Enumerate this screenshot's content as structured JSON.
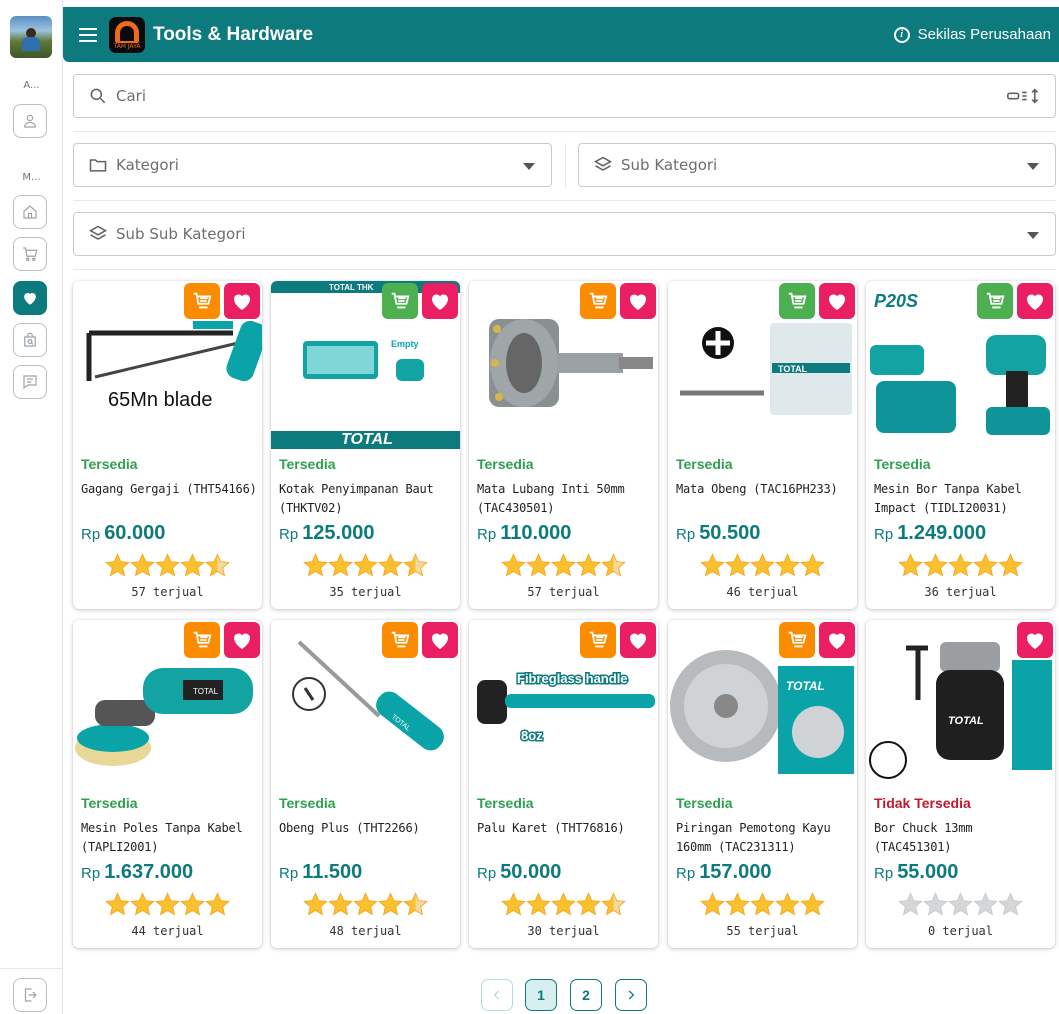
{
  "app": {
    "title": "Tools & Hardware",
    "logo_text": "TAM JAYA",
    "company_link": "Sekilas Perusahaan"
  },
  "rail": {
    "section_account": "A...",
    "section_menu": "M...",
    "items": [
      {
        "icon": "user-icon"
      },
      {
        "icon": "home-icon"
      },
      {
        "icon": "cart-icon"
      },
      {
        "icon": "heart-icon",
        "active": true
      },
      {
        "icon": "bag-search-icon"
      },
      {
        "icon": "chat-icon"
      },
      {
        "icon": "logout-icon"
      }
    ]
  },
  "search": {
    "placeholder": "Cari"
  },
  "filters": {
    "kategori": "Kategori",
    "sub_kategori": "Sub Kategori",
    "sub_sub_kategori": "Sub Sub Kategori"
  },
  "colors": {
    "primary": "#0d7a7d",
    "available": "#2ea04f",
    "unavailable": "#c0182e",
    "cart_orange": "#fb8c00",
    "cart_green": "#4caf50",
    "fav": "#e91e63",
    "star": "#fbc02d"
  },
  "products": [
    {
      "status": "Tersedia",
      "available": true,
      "name": "Gagang Gergaji (THT54166)",
      "currency": "Rp",
      "price": "60.000",
      "rating": 4.5,
      "sold": "57 terjual",
      "cart": "orange",
      "image_text": "65Mn blade"
    },
    {
      "status": "Tersedia",
      "available": true,
      "name": "Kotak Penyimpanan Baut (THKTV02)",
      "currency": "Rp",
      "price": "125.000",
      "rating": 4.5,
      "sold": "35 terjual",
      "cart": "green",
      "image_text": "TOTAL"
    },
    {
      "status": "Tersedia",
      "available": true,
      "name": "Mata Lubang Inti 50mm (TAC430501)",
      "currency": "Rp",
      "price": "110.000",
      "rating": 4.5,
      "sold": "57 terjual",
      "cart": "orange",
      "image_text": ""
    },
    {
      "status": "Tersedia",
      "available": true,
      "name": "Mata Obeng (TAC16PH233)",
      "currency": "Rp",
      "price": "50.500",
      "rating": 5,
      "sold": "46 terjual",
      "cart": "green",
      "image_text": "TOTAL"
    },
    {
      "status": "Tersedia",
      "available": true,
      "name": "Mesin Bor Tanpa Kabel Impact (TIDLI20031)",
      "currency": "Rp",
      "price": "1.249.000",
      "rating": 5,
      "sold": "36 terjual",
      "cart": "green",
      "image_text": "P20S"
    },
    {
      "status": "Tersedia",
      "available": true,
      "name": "Mesin Poles Tanpa Kabel (TAPLI2001)",
      "currency": "Rp",
      "price": "1.637.000",
      "rating": 5,
      "sold": "44 terjual",
      "cart": "orange",
      "image_text": "TOTAL"
    },
    {
      "status": "Tersedia",
      "available": true,
      "name": "Obeng Plus (THT2266)",
      "currency": "Rp",
      "price": "11.500",
      "rating": 4.5,
      "sold": "48 terjual",
      "cart": "orange",
      "image_text": "TOTAL"
    },
    {
      "status": "Tersedia",
      "available": true,
      "name": "Palu Karet (THT76816)",
      "currency": "Rp",
      "price": "50.000",
      "rating": 4.5,
      "sold": "30 terjual",
      "cart": "orange",
      "image_text": "Fibreglass handle"
    },
    {
      "status": "Tersedia",
      "available": true,
      "name": "Piringan Pemotong Kayu 160mm (TAC231311)",
      "currency": "Rp",
      "price": "157.000",
      "rating": 5,
      "sold": "55 terjual",
      "cart": "orange",
      "image_text": "TOTAL"
    },
    {
      "status": "Tidak Tersedia",
      "available": false,
      "name": "Bor Chuck 13mm (TAC451301)",
      "currency": "Rp",
      "price": "55.000",
      "rating": 0,
      "sold": "0 terjual",
      "cart": null,
      "image_text": "TOTAL"
    }
  ],
  "pagination": {
    "pages": [
      "1",
      "2"
    ],
    "current": "1"
  }
}
